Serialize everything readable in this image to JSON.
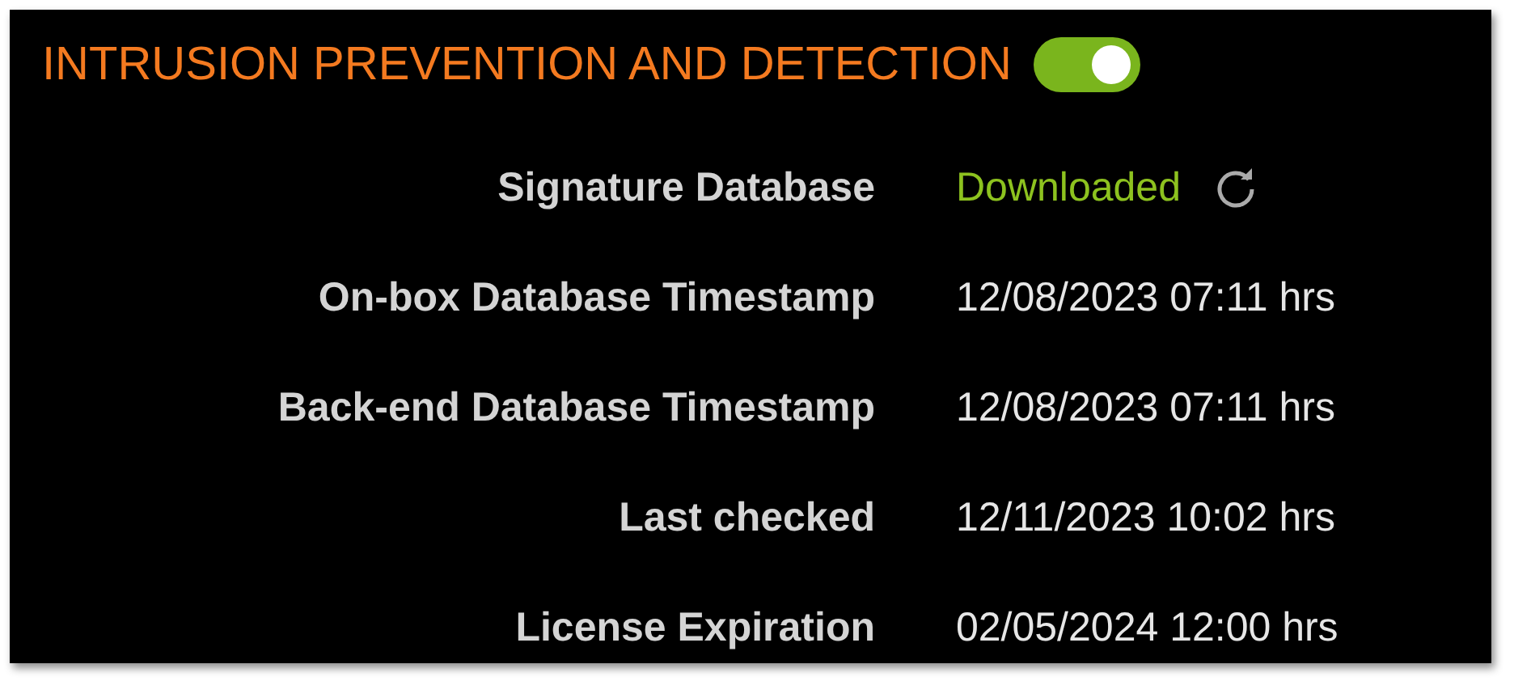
{
  "section": {
    "title": "INTRUSION PREVENTION AND DETECTION",
    "enabled": true
  },
  "rows": [
    {
      "label": "Signature Database",
      "value": "Downloaded",
      "kind": "status"
    },
    {
      "label": "On-box Database Timestamp",
      "value": "12/08/2023 07:11 hrs",
      "kind": "text"
    },
    {
      "label": "Back-end Database Timestamp",
      "value": "12/08/2023 07:11 hrs",
      "kind": "text"
    },
    {
      "label": "Last checked",
      "value": "12/11/2023 10:02 hrs",
      "kind": "text"
    },
    {
      "label": "License Expiration",
      "value": "02/05/2024 12:00 hrs",
      "kind": "text"
    }
  ]
}
